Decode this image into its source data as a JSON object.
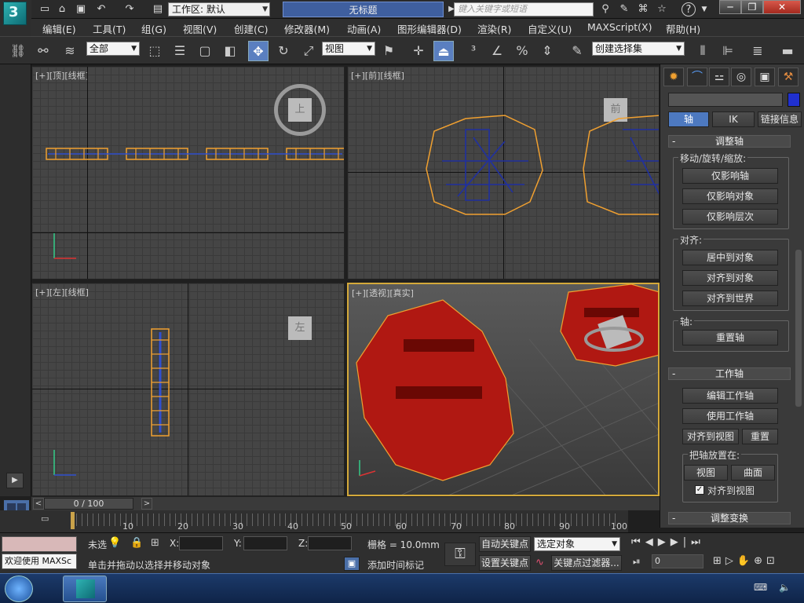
{
  "titlebar": {
    "workspace": "工作区: 默认",
    "doc_title": "无标题",
    "search_placeholder": "键入关键字或短语"
  },
  "menus": [
    "编辑(E)",
    "工具(T)",
    "组(G)",
    "视图(V)",
    "创建(C)",
    "修改器(M)",
    "动画(A)",
    "图形编辑器(D)",
    "渲染(R)",
    "自定义(U)",
    "MAXScript(X)",
    "帮助(H)"
  ],
  "toolbar": {
    "selection_filter": "全部",
    "ref_coord": "视图",
    "named_selection": "创建选择集"
  },
  "viewports": {
    "top": {
      "label": "[+][顶][线框]",
      "cube": "上"
    },
    "front": {
      "label": "[+][前][线框]",
      "cube": "前"
    },
    "left": {
      "label": "[+][左][线框]",
      "cube": "左"
    },
    "persp": {
      "label": "[+][透视][真实]"
    }
  },
  "cmd_panel": {
    "tabs": [
      "create",
      "modify",
      "hierarchy",
      "motion",
      "display",
      "utilities"
    ],
    "hier_buttons": [
      "轴",
      "IK",
      "链接信息"
    ],
    "adjust_pivot": {
      "title": "调整轴",
      "move_group": "移动/旋转/缩放:",
      "move_buttons": [
        "仅影响轴",
        "仅影响对象",
        "仅影响层次"
      ],
      "align_group": "对齐:",
      "align_buttons": [
        "居中到对象",
        "对齐到对象",
        "对齐到世界"
      ],
      "pivot_group": "轴:",
      "reset_pivot": "重置轴"
    },
    "working_pivot": {
      "title": "工作轴",
      "buttons": [
        "编辑工作轴",
        "使用工作轴"
      ],
      "align_view": "对齐到视图",
      "reset": "重置",
      "place_group": "把轴放置在:",
      "place_buttons": [
        "视图",
        "曲面"
      ],
      "align_view_check": "对齐到视图"
    },
    "adjust_transform": "调整变换"
  },
  "timeslider": {
    "frame": "0 / 100"
  },
  "trackbar": {
    "ticks": [
      "10",
      "20",
      "30",
      "40",
      "50",
      "60",
      "70",
      "80",
      "90",
      "100"
    ]
  },
  "status": {
    "welcome": "欢迎使用 MAXSc",
    "selected": "未选",
    "prompt": "单击并拖动以选择并移动对象",
    "x_label": "X:",
    "y_label": "Y:",
    "z_label": "Z:",
    "grid": "栅格 = 10.0mm",
    "add_time_tag": "添加时间标记",
    "auto_key": "自动关键点",
    "set_key": "设置关键点",
    "key_mode": "选定对象",
    "key_filters": "关键点过滤器...",
    "frame_value": "0"
  },
  "colors": {
    "accent": "#4d79c0",
    "selection": "#e8a640",
    "viewport_border": "#d4a93a"
  }
}
